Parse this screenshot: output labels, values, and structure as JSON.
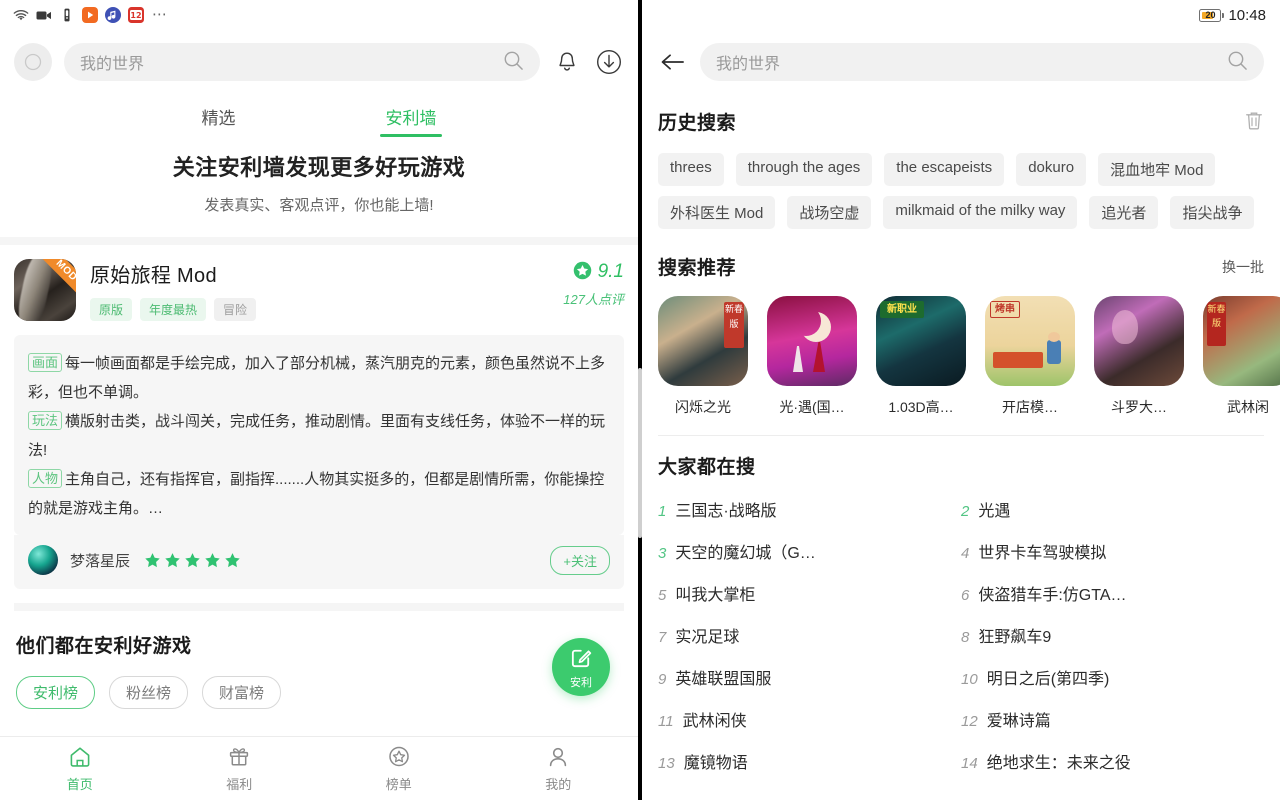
{
  "left": {
    "statusbar": {
      "icons": [
        "wifi-icon",
        "video-camera-icon",
        "vibrate-icon",
        "video-app-icon",
        "music-app-icon",
        "calendar-app-icon"
      ],
      "overflow": "⋯"
    },
    "header": {
      "avatar_icon": "user-avatar-icon",
      "search_placeholder": "我的世界",
      "search_icon": "search-icon",
      "bell_icon": "bell-icon",
      "download_icon": "download-icon"
    },
    "tabs": [
      {
        "label": "精选",
        "active": false
      },
      {
        "label": "安利墙",
        "active": true
      }
    ],
    "hero": {
      "title": "关注安利墙发现更多好玩游戏",
      "subtitle": "发表真实、客观点评，你也能上墙!"
    },
    "review_card": {
      "app_name": "原始旅程 Mod",
      "icon_badge": "MOD",
      "tags": [
        "原版",
        "年度最热",
        "冒险"
      ],
      "score": "9.1",
      "score_sub": "127人点评",
      "paragraphs": [
        {
          "label": "画面",
          "text": "每一帧画面都是手绘完成，加入了部分机械，蒸汽朋克的元素，颜色虽然说不上多彩，但也不单调。"
        },
        {
          "label": "玩法",
          "text": "横版射击类，战斗闯关，完成任务，推动剧情。里面有支线任务，体验不一样的玩法!"
        },
        {
          "label": "人物",
          "text": "主角自己，还有指挥官，副指挥.......人物其实挺多的，但都是剧情所需，你能操控的就是游戏主角。…"
        }
      ],
      "reviewer_name": "梦落星辰",
      "stars": 5,
      "follow_label": "+关注"
    },
    "section2": {
      "title": "他们都在安利好游戏",
      "chips": [
        {
          "label": "安利榜",
          "active": true
        },
        {
          "label": "粉丝榜",
          "active": false
        },
        {
          "label": "财富榜",
          "active": false
        }
      ]
    },
    "fab": {
      "label": "安利",
      "icon": "edit-square-icon"
    },
    "bottom_nav": [
      {
        "label": "首页",
        "icon": "home-icon",
        "active": true
      },
      {
        "label": "福利",
        "icon": "gift-icon",
        "active": false
      },
      {
        "label": "榜单",
        "icon": "star-circle-icon",
        "active": false
      },
      {
        "label": "我的",
        "icon": "person-icon",
        "active": false
      }
    ]
  },
  "right": {
    "statusbar": {
      "battery_level": "20",
      "time": "10:48"
    },
    "header": {
      "back_icon": "back-arrow-icon",
      "search_placeholder": "我的世界",
      "search_icon": "search-icon"
    },
    "history": {
      "title": "历史搜索",
      "clear_icon": "trash-icon",
      "items": [
        "threes",
        "through the ages",
        "the escapeists",
        "dokuro",
        "混血地牢 Mod",
        "外科医生 Mod",
        "战场空虚",
        "milkmaid of the milky way",
        "追光者",
        "指尖战争"
      ]
    },
    "recommend": {
      "title": "搜索推荐",
      "action": "换一批",
      "items": [
        {
          "name": "闪烁之光",
          "badge": "新春版"
        },
        {
          "name": "光·遇(国…",
          "badge": ""
        },
        {
          "name": "1.03D高…",
          "badge": "新职业"
        },
        {
          "name": "开店模…",
          "badge": "烤串"
        },
        {
          "name": "斗罗大…",
          "badge": ""
        },
        {
          "name": "武林闲",
          "badge": "新春版"
        }
      ]
    },
    "hot": {
      "title": "大家都在搜",
      "items": [
        {
          "rank": "1",
          "name": "三国志·战略版"
        },
        {
          "rank": "2",
          "name": "光遇"
        },
        {
          "rank": "3",
          "name": "天空的魔幻城（G…"
        },
        {
          "rank": "4",
          "name": "世界卡车驾驶模拟"
        },
        {
          "rank": "5",
          "name": "叫我大掌柜"
        },
        {
          "rank": "6",
          "name": "侠盗猎车手:仿GTA…"
        },
        {
          "rank": "7",
          "name": "实况足球"
        },
        {
          "rank": "8",
          "name": "狂野飙车9"
        },
        {
          "rank": "9",
          "name": "英雄联盟国服"
        },
        {
          "rank": "10",
          "name": "明日之后(第四季)"
        },
        {
          "rank": "11",
          "name": "武林闲侠"
        },
        {
          "rank": "12",
          "name": "爱琳诗篇"
        },
        {
          "rank": "13",
          "name": "魔镜物语"
        },
        {
          "rank": "14",
          "name": "绝地求生：未来之役"
        }
      ]
    }
  },
  "colors": {
    "accent_green": "#3fbb6c",
    "tag_green_bg": "#eaf7ee",
    "chip_grey_bg": "#f2f2f2",
    "battery_orange": "#f3a928"
  }
}
